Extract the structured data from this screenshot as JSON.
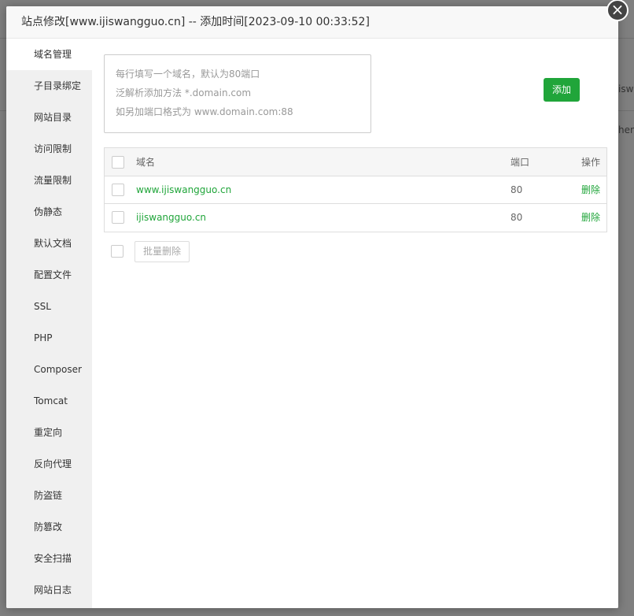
{
  "modal": {
    "title": "站点修改[www.ijiswangguo.cn] -- 添加时间[2023-09-10 00:33:52]",
    "close_glyph": "×"
  },
  "background": {
    "partial_text_1": "iswa",
    "partial_text_2": "henc"
  },
  "sidebar": {
    "items": [
      {
        "label": "域名管理"
      },
      {
        "label": "子目录绑定"
      },
      {
        "label": "网站目录"
      },
      {
        "label": "访问限制"
      },
      {
        "label": "流量限制"
      },
      {
        "label": "伪静态"
      },
      {
        "label": "默认文档"
      },
      {
        "label": "配置文件"
      },
      {
        "label": "SSL"
      },
      {
        "label": "PHP"
      },
      {
        "label": "Composer"
      },
      {
        "label": "Tomcat"
      },
      {
        "label": "重定向"
      },
      {
        "label": "反向代理"
      },
      {
        "label": "防盗链"
      },
      {
        "label": "防篡改"
      },
      {
        "label": "安全扫描"
      },
      {
        "label": "网站日志"
      }
    ],
    "active_index": 0
  },
  "domain_form": {
    "placeholder_lines": [
      "每行填写一个域名，默认为80端口",
      "泛解析添加方法 *.domain.com",
      "如另加端口格式为 www.domain.com:88"
    ],
    "add_label": "添加"
  },
  "table": {
    "headers": {
      "domain": "域名",
      "port": "端口",
      "action": "操作"
    },
    "rows": [
      {
        "domain": "www.ijiswangguo.cn",
        "port": "80",
        "action": "删除"
      },
      {
        "domain": "ijiswangguo.cn",
        "port": "80",
        "action": "删除"
      }
    ]
  },
  "batch": {
    "delete_label": "批量删除"
  },
  "colors": {
    "accent": "#20a53a",
    "sidebar_bg": "#f0f0f0"
  }
}
